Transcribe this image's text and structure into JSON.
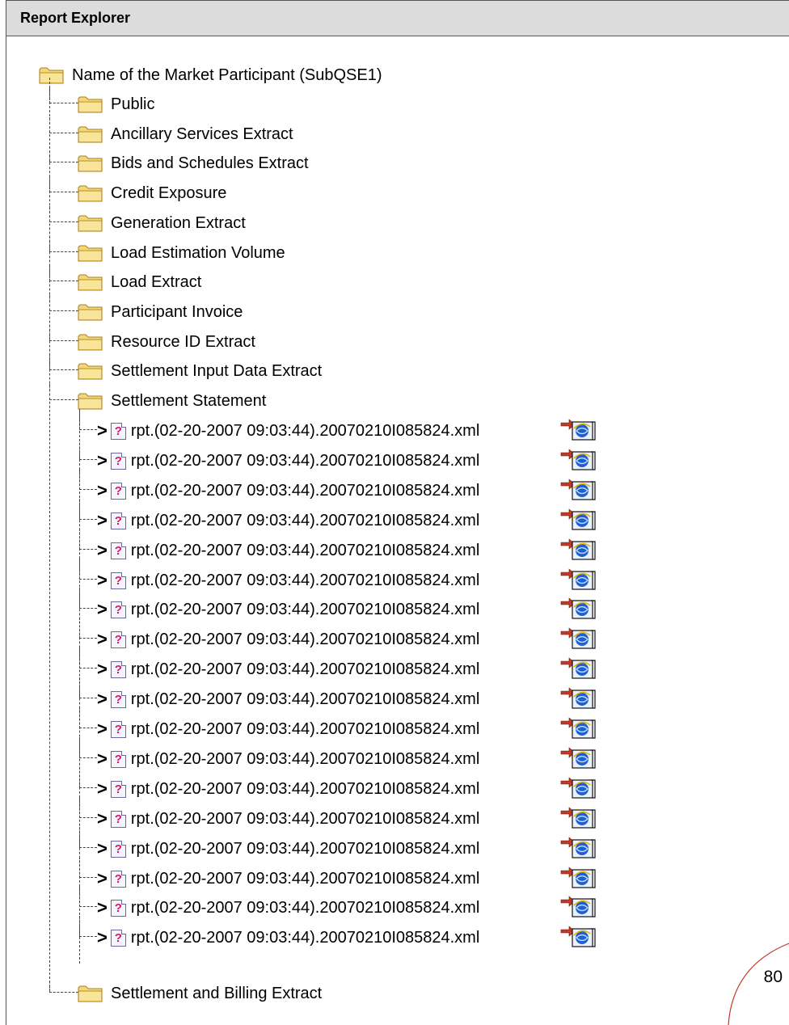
{
  "panel": {
    "title": "Report Explorer"
  },
  "tree": {
    "root": "Name of the Market Participant (SubQSE1)",
    "folders": [
      "Public",
      "Ancillary Services Extract",
      "Bids and Schedules Extract",
      "Credit Exposure",
      "Generation Extract",
      "Load Estimation Volume",
      "Load Extract",
      "Participant Invoice",
      "Resource ID Extract",
      "Settlement Input Data Extract",
      "Settlement Statement"
    ],
    "files": [
      "rpt.(02-20-2007 09:03:44).20070210I085824.xml",
      "rpt.(02-20-2007 09:03:44).20070210I085824.xml",
      "rpt.(02-20-2007 09:03:44).20070210I085824.xml",
      "rpt.(02-20-2007 09:03:44).20070210I085824.xml",
      "rpt.(02-20-2007 09:03:44).20070210I085824.xml",
      "rpt.(02-20-2007 09:03:44).20070210I085824.xml",
      "rpt.(02-20-2007 09:03:44).20070210I085824.xml",
      "rpt.(02-20-2007 09:03:44).20070210I085824.xml",
      "rpt.(02-20-2007 09:03:44).20070210I085824.xml",
      "rpt.(02-20-2007 09:03:44).20070210I085824.xml",
      "rpt.(02-20-2007 09:03:44).20070210I085824.xml",
      "rpt.(02-20-2007 09:03:44).20070210I085824.xml",
      "rpt.(02-20-2007 09:03:44).20070210I085824.xml",
      "rpt.(02-20-2007 09:03:44).20070210I085824.xml",
      "rpt.(02-20-2007 09:03:44).20070210I085824.xml",
      "rpt.(02-20-2007 09:03:44).20070210I085824.xml",
      "rpt.(02-20-2007 09:03:44).20070210I085824.xml",
      "rpt.(02-20-2007 09:03:44).20070210I085824.xml"
    ],
    "last_folder": "Settlement and Billing Extract",
    "icons": {
      "folder": "folder-icon",
      "file": "unknown-file-icon",
      "open": "open-in-browser-icon"
    }
  },
  "page": {
    "number": "80"
  },
  "colors": {
    "header_bg": "#dcdcdc",
    "folder_fill": "#f3d77a",
    "folder_edge": "#a87f1c",
    "file_question": "#d81b60",
    "open_arrow": "#c0392b",
    "open_globe": "#1f5fd1"
  }
}
